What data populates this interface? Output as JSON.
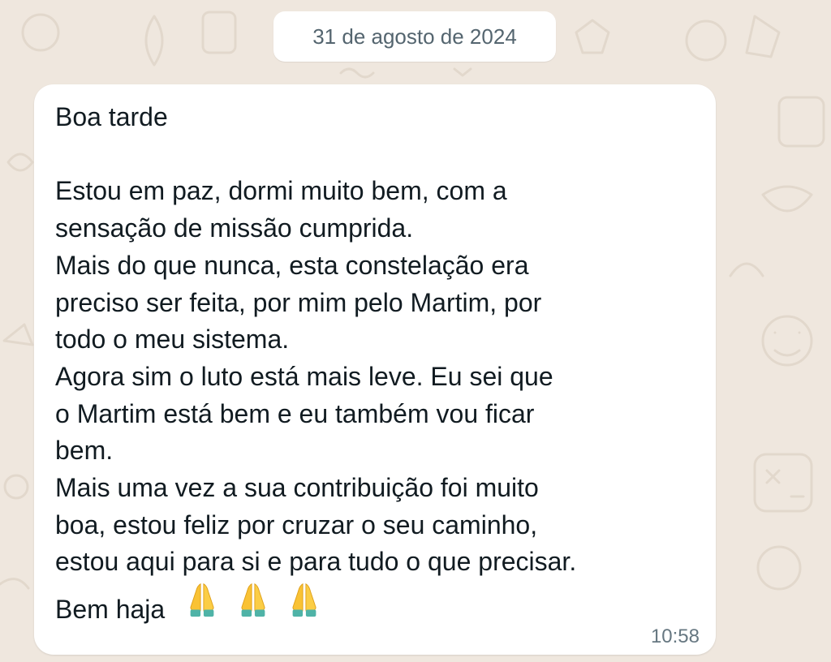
{
  "chat": {
    "date_chip": "31 de agosto de 2024",
    "message": {
      "lines": [
        "Boa tarde",
        "",
        "Estou em paz, dormi muito bem, com a",
        "sensação de missão cumprida.",
        "Mais do que nunca, esta constelação era",
        "preciso ser feita, por mim pelo Martim, por",
        "todo o meu sistema.",
        "Agora sim o luto está mais leve. Eu sei que",
        "o Martim está bem e eu também vou ficar",
        "bem.",
        "Mais uma vez a sua contribuição foi muito",
        "boa, estou feliz por cruzar o seu caminho,",
        "estou aqui para si e para tudo o que precisar."
      ],
      "closing": "Bem haja",
      "closing_emoji": [
        "folded-hands-icon",
        "folded-hands-icon",
        "folded-hands-icon"
      ],
      "time": "10:58"
    }
  },
  "colors": {
    "background": "#efe7de",
    "bubble": "#ffffff",
    "text": "#111b21",
    "meta_text": "#667781"
  }
}
